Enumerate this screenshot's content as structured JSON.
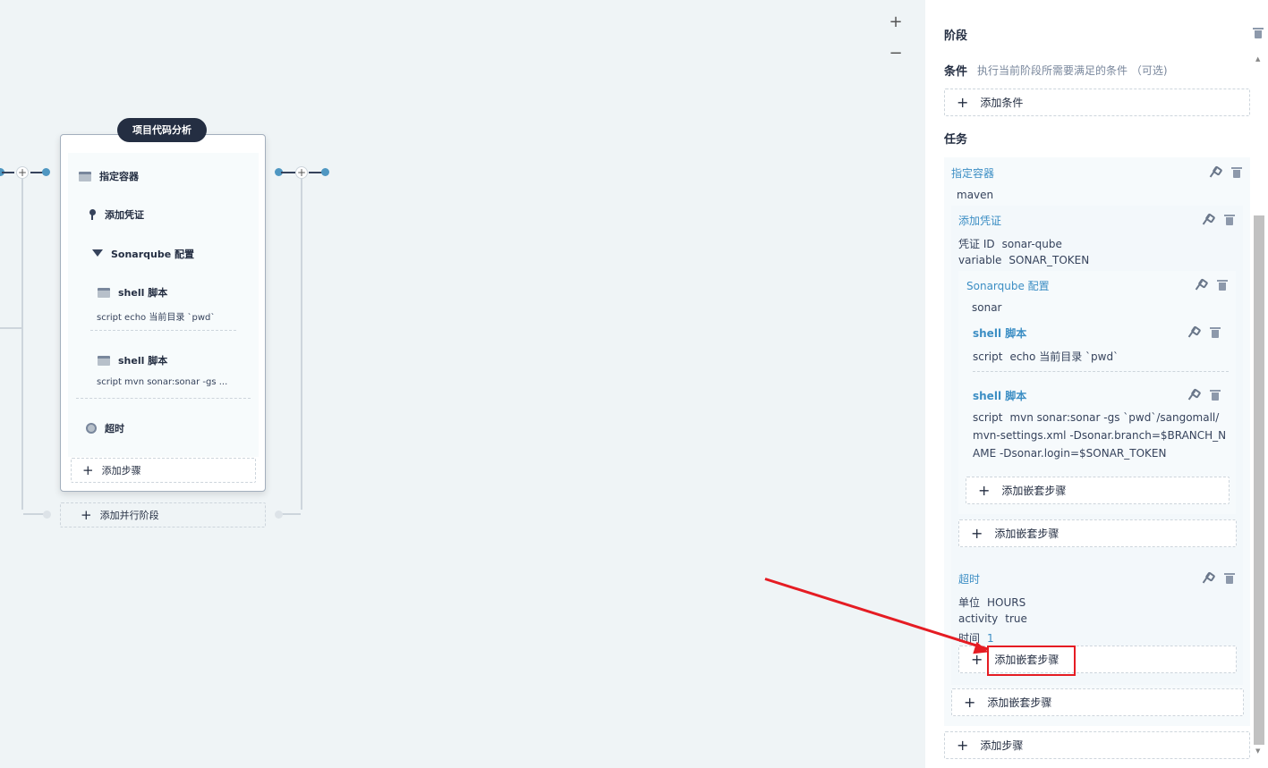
{
  "canvas": {
    "zoom_in": "+",
    "zoom_out": "−",
    "stage": {
      "title": "项目代码分析",
      "tasks": [
        {
          "label": "指定容器",
          "icon": "container-icon"
        },
        {
          "label": "添加凭证",
          "icon": "key-icon"
        },
        {
          "label": "Sonarqube 配置",
          "icon": "sonar-icon"
        },
        {
          "label": "shell 脚本",
          "icon": "terminal-icon",
          "detail": "script   echo 当前目录 `pwd`"
        },
        {
          "label": "shell 脚本",
          "icon": "terminal-icon",
          "detail": "script   mvn sonar:sonar -gs ..."
        },
        {
          "label": "超时",
          "icon": "clock-icon"
        }
      ],
      "add_step": "添加步骤",
      "add_parallel": "添加并行阶段"
    }
  },
  "panel": {
    "title": "阶段",
    "condition_label": "条件",
    "condition_desc": "执行当前阶段所需要满足的条件 （可选)",
    "add_condition": "添加条件",
    "task_label": "任务",
    "container": {
      "title": "指定容器",
      "value": "maven"
    },
    "credential": {
      "title": "添加凭证",
      "fields": [
        {
          "key": "凭证 ID",
          "value": "sonar-qube"
        },
        {
          "key": "variable",
          "value": "SONAR_TOKEN"
        }
      ]
    },
    "sonar": {
      "title": "Sonarqube 配置",
      "value": "sonar"
    },
    "shell1": {
      "title": "shell 脚本",
      "key": "script",
      "value": "echo 当前目录 `pwd`"
    },
    "shell2": {
      "title": "shell 脚本",
      "key": "script",
      "value": "mvn sonar:sonar -gs `pwd`/sangomall/mvn-settings.xml -Dsonar.branch=$BRANCH_NAME -Dsonar.login=$SONAR_TOKEN"
    },
    "add_nested_1": "添加嵌套步骤",
    "add_nested_2": "添加嵌套步骤",
    "timeout": {
      "title": "超时",
      "fields": [
        {
          "key": "单位",
          "value": "HOURS"
        },
        {
          "key": "activity",
          "value": "true"
        },
        {
          "key": "时间",
          "value": "1"
        }
      ]
    },
    "add_nested_3": "添加嵌套步骤",
    "add_nested_4": "添加嵌套步骤",
    "add_step": "添加步骤"
  },
  "colors": {
    "accent": "#3c8ec4",
    "annotation": "#e51c23",
    "stage_title_bg": "#242e42"
  }
}
